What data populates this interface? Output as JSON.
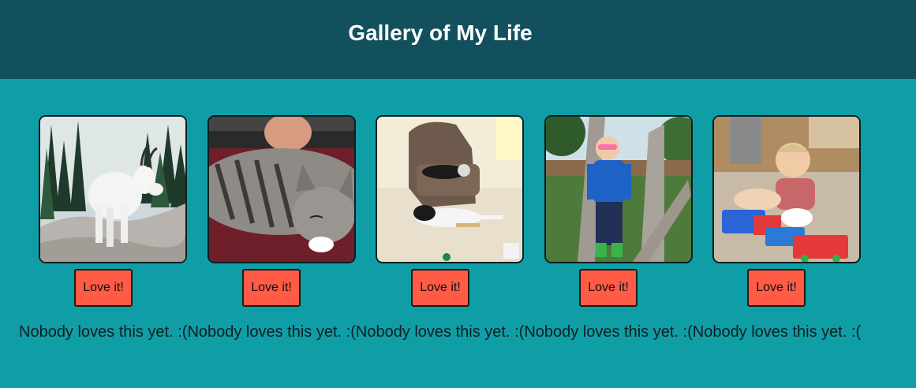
{
  "page": {
    "title": "Gallery of My Life",
    "colors": {
      "header_bg": "#12505d",
      "body_bg": "#109ea6",
      "button_bg": "#ff5b45"
    }
  },
  "gallery": {
    "photos": [
      {
        "subject": "mountain goat on rocks with pine trees",
        "button_label": "Love it!",
        "status": "Nobody loves this yet. :("
      },
      {
        "subject": "tabby cat sleeping on lap",
        "button_label": "Love it!",
        "status": "Nobody loves this yet. :("
      },
      {
        "subject": "dogs resting by recliner",
        "button_label": "Love it!",
        "status": "Nobody loves this yet. :("
      },
      {
        "subject": "child in sunglasses by tree",
        "button_label": "Love it!",
        "status": "Nobody loves this yet. :("
      },
      {
        "subject": "toddler playing with toy train",
        "button_label": "Love it!",
        "status": "Nobody loves this yet. :("
      }
    ]
  }
}
